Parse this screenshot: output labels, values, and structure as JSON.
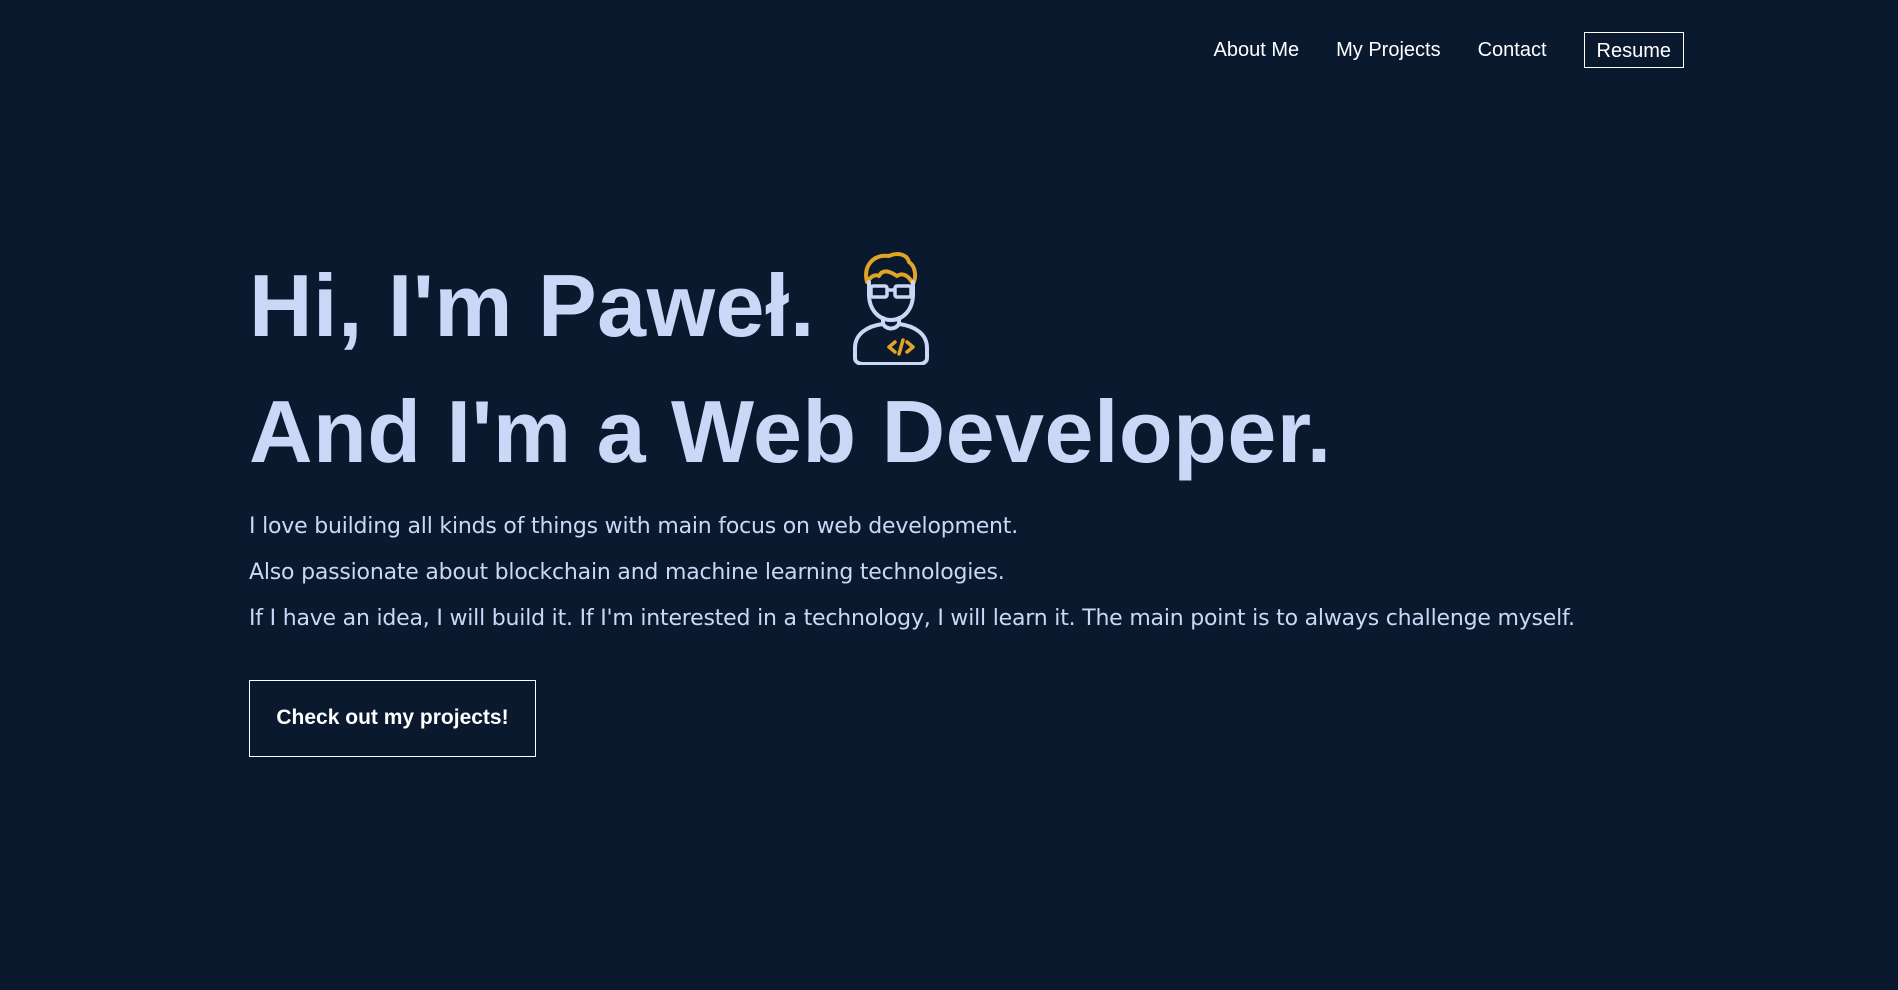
{
  "nav": {
    "items": [
      {
        "label": "About Me"
      },
      {
        "label": "My Projects"
      },
      {
        "label": "Contact"
      }
    ],
    "resume_label": "Resume"
  },
  "hero": {
    "greeting": "Hi, I'm Paweł.",
    "tagline": "And I'm a Web Developer.",
    "paragraphs": [
      "I love building all kinds of things with main focus on web development.",
      "Also passionate about blockchain and machine learning technologies.",
      "If I have an idea, I will build it. If I'm interested in a technology, I will learn it. The main point is to always challenge myself."
    ],
    "cta_label": "Check out my projects!",
    "icon": "web-developer-icon"
  },
  "colors": {
    "background": "#0b192f",
    "text": "#ccd6f6",
    "accent": "#e0a526",
    "white": "#ffffff"
  }
}
